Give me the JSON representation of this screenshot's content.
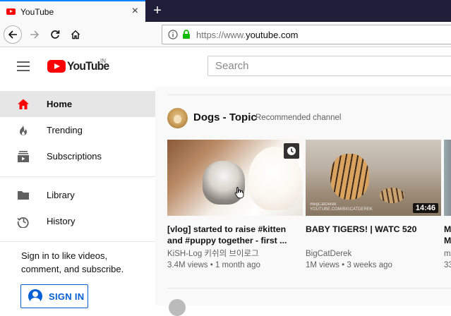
{
  "browser": {
    "tab_title": "YouTube",
    "tab_close": "×",
    "new_tab": "+",
    "url_host_prefix": "https://www.",
    "url_host": "youtube.com"
  },
  "header": {
    "logo_text": "YouTube",
    "region": "IN",
    "search_placeholder": "Search"
  },
  "sidebar": {
    "items": [
      {
        "label": "Home",
        "icon": "home-icon",
        "active": true
      },
      {
        "label": "Trending",
        "icon": "flame-icon"
      },
      {
        "label": "Subscriptions",
        "icon": "subscriptions-icon"
      },
      {
        "label": "Library",
        "icon": "folder-icon"
      },
      {
        "label": "History",
        "icon": "history-icon"
      }
    ],
    "signin_text": "Sign in to like videos, comment, and subscribe.",
    "signin_button": "SIGN IN"
  },
  "shelf": {
    "title": "Dogs - Topic",
    "subtitle": "Recommended channel",
    "videos": [
      {
        "title": "[vlog] started to raise #kitten and #puppy together - first ...",
        "channel": "KiSH-Log 키쉬의 브이로그",
        "meta": "3.4M views • 1 month ago",
        "badge": "watch-later-icon"
      },
      {
        "title": "BABY TIGERS! | WATC 520",
        "channel": "BigCatDerek",
        "meta": "1M views • 3 weeks ago",
        "duration": "14:46",
        "watermark": "#BigCatDerek\nYOUTUBE.COM/BIGCATDEREK"
      },
      {
        "title": "M",
        "title2": "M",
        "channel": "m",
        "meta": "33"
      }
    ]
  },
  "colors": {
    "accent_red": "#ff0000",
    "link_blue": "#065fd4",
    "tabbar": "#1f1f3a"
  }
}
